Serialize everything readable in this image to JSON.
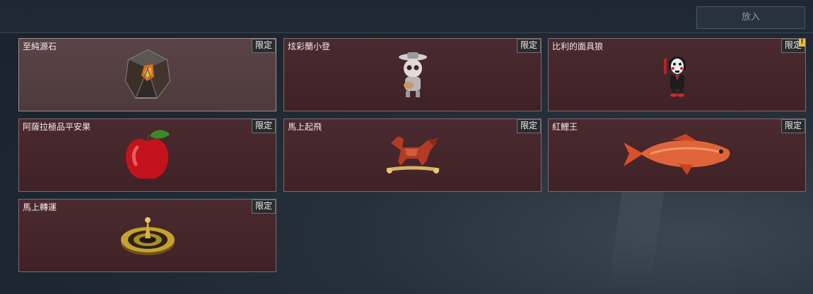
{
  "toolbar": {
    "put_in_label": "放入"
  },
  "items": [
    {
      "name": "至純源石",
      "tag": "限定",
      "selected": true,
      "icon": "crystal-icon"
    },
    {
      "name": "炫彩蘭小登",
      "tag": "限定",
      "selected": false,
      "icon": "doll-icon"
    },
    {
      "name": "比利的面具狼",
      "tag": "限定",
      "selected": false,
      "icon": "puppet-icon",
      "warning": "!"
    },
    {
      "name": "阿薩拉極品平安果",
      "tag": "限定",
      "selected": false,
      "icon": "apple-icon"
    },
    {
      "name": "馬上起飛",
      "tag": "限定",
      "selected": false,
      "icon": "horse-icon"
    },
    {
      "name": "紅鯉王",
      "tag": "限定",
      "selected": false,
      "icon": "carp-icon"
    },
    {
      "name": "馬上轉運",
      "tag": "限定",
      "selected": false,
      "icon": "compass-icon"
    }
  ]
}
